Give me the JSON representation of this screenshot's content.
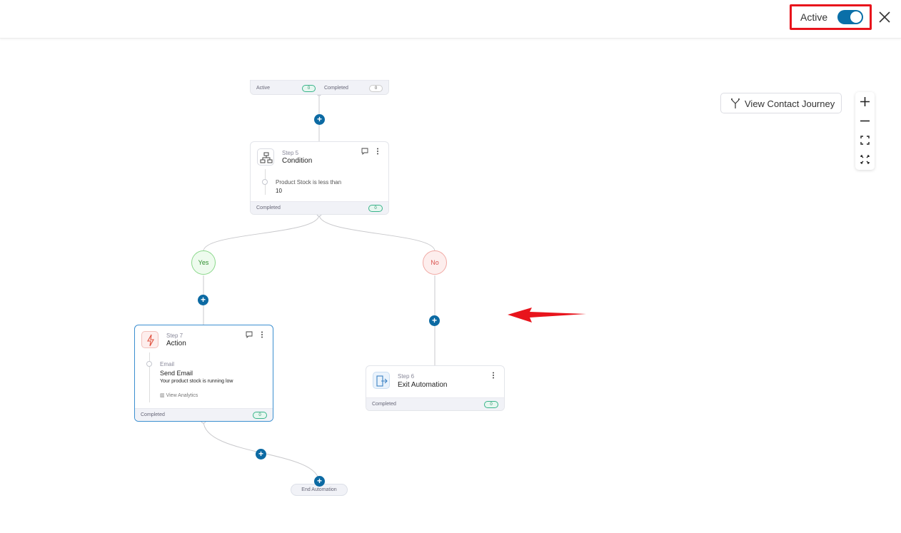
{
  "topbar": {
    "status_label": "Active",
    "toggle_on": true,
    "close_icon": "close-icon"
  },
  "toolbar": {
    "journey_label": "View Contact Journey",
    "journey_icon": "branch-icon",
    "zoom_in_icon": "plus-icon",
    "zoom_out_icon": "minus-icon",
    "fit_icon": "fit-screen-icon",
    "fullscreen_icon": "fullscreen-icon"
  },
  "nodes": {
    "prev": {
      "active_label": "Active",
      "active_count": "0",
      "completed_label": "Completed",
      "completed_count": "0"
    },
    "condition": {
      "step": "Step 5",
      "title": "Condition",
      "rule_line1": "Product Stock is less than",
      "rule_line2": "10",
      "footer_label": "Completed",
      "count": "0"
    },
    "action": {
      "step": "Step 7",
      "title": "Action",
      "type": "Email",
      "name": "Send Email",
      "subject": "Your product stock is running low",
      "analytics": "View Analytics",
      "footer_label": "Completed",
      "count": "0"
    },
    "exit": {
      "step": "Step 6",
      "title": "Exit Automation",
      "footer_label": "Completed",
      "count": "0"
    }
  },
  "branches": {
    "yes": "Yes",
    "no": "No"
  },
  "end_label": "End Automation",
  "colors": {
    "accent": "#0c6aa3",
    "highlight": "#e8141c",
    "arrow": "#e8141c",
    "success": "#39b48a"
  }
}
